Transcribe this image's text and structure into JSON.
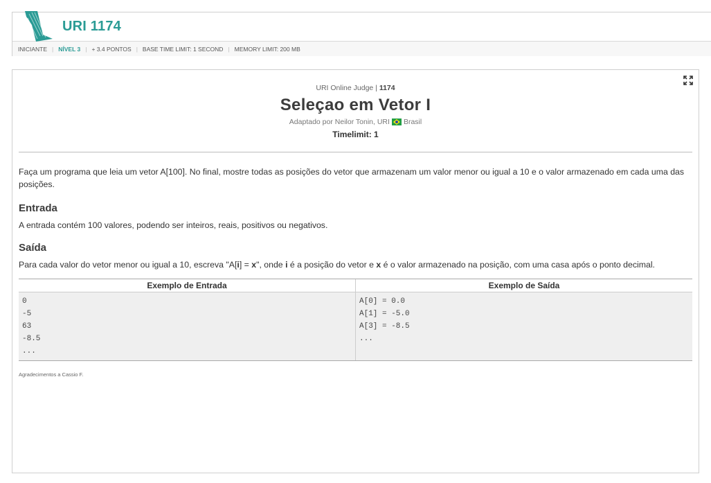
{
  "header": {
    "problem_code": "URI 1174",
    "meta": {
      "category": "INICIANTE",
      "level": "NÍVEL 3",
      "points": "+ 3.4 PONTOS",
      "time_limit": "BASE TIME LIMIT: 1 SECOND",
      "memory_limit": "MEMORY LIMIT: 200 MB"
    },
    "brand_color": "#2a9b95"
  },
  "problem": {
    "judge": "URI Online Judge",
    "number": "1174",
    "title": "Seleçao em Vetor I",
    "author": "Adaptado por Neilor Tonin, URI",
    "country": "Brasil",
    "timelimit": "Timelimit: 1",
    "description": "Faça um programa que leia um vetor A[100]. No final, mostre todas as posições do vetor que armazenam um valor menor ou igual a 10 e o valor armazenado em cada uma das posições.",
    "input_title": "Entrada",
    "input_text": "A entrada contém 100 valores, podendo ser inteiros, reais, positivos ou negativos.",
    "output_title": "Saída",
    "output_text": {
      "p1": "Para cada valor do vetor menor ou igual a 10, escreva \"A[",
      "b1": "i",
      "p2": "] = ",
      "b2": "x",
      "p3": "\", onde ",
      "b3": "i",
      "p4": " é a posição do vetor e ",
      "b4": "x",
      "p5": " é o valor armazenado na posição, com uma casa após o ponto decimal."
    },
    "samples": {
      "input_header": "Exemplo de Entrada",
      "output_header": "Exemplo de Saída",
      "input_lines": [
        "0",
        "-5",
        "63",
        "-8.5",
        "..."
      ],
      "output_lines": [
        "A[0] = 0.0",
        "A[1] = -5.0",
        "A[3] = -8.5",
        "..."
      ]
    },
    "thanks": "Agradecimentos a Cassio F."
  }
}
